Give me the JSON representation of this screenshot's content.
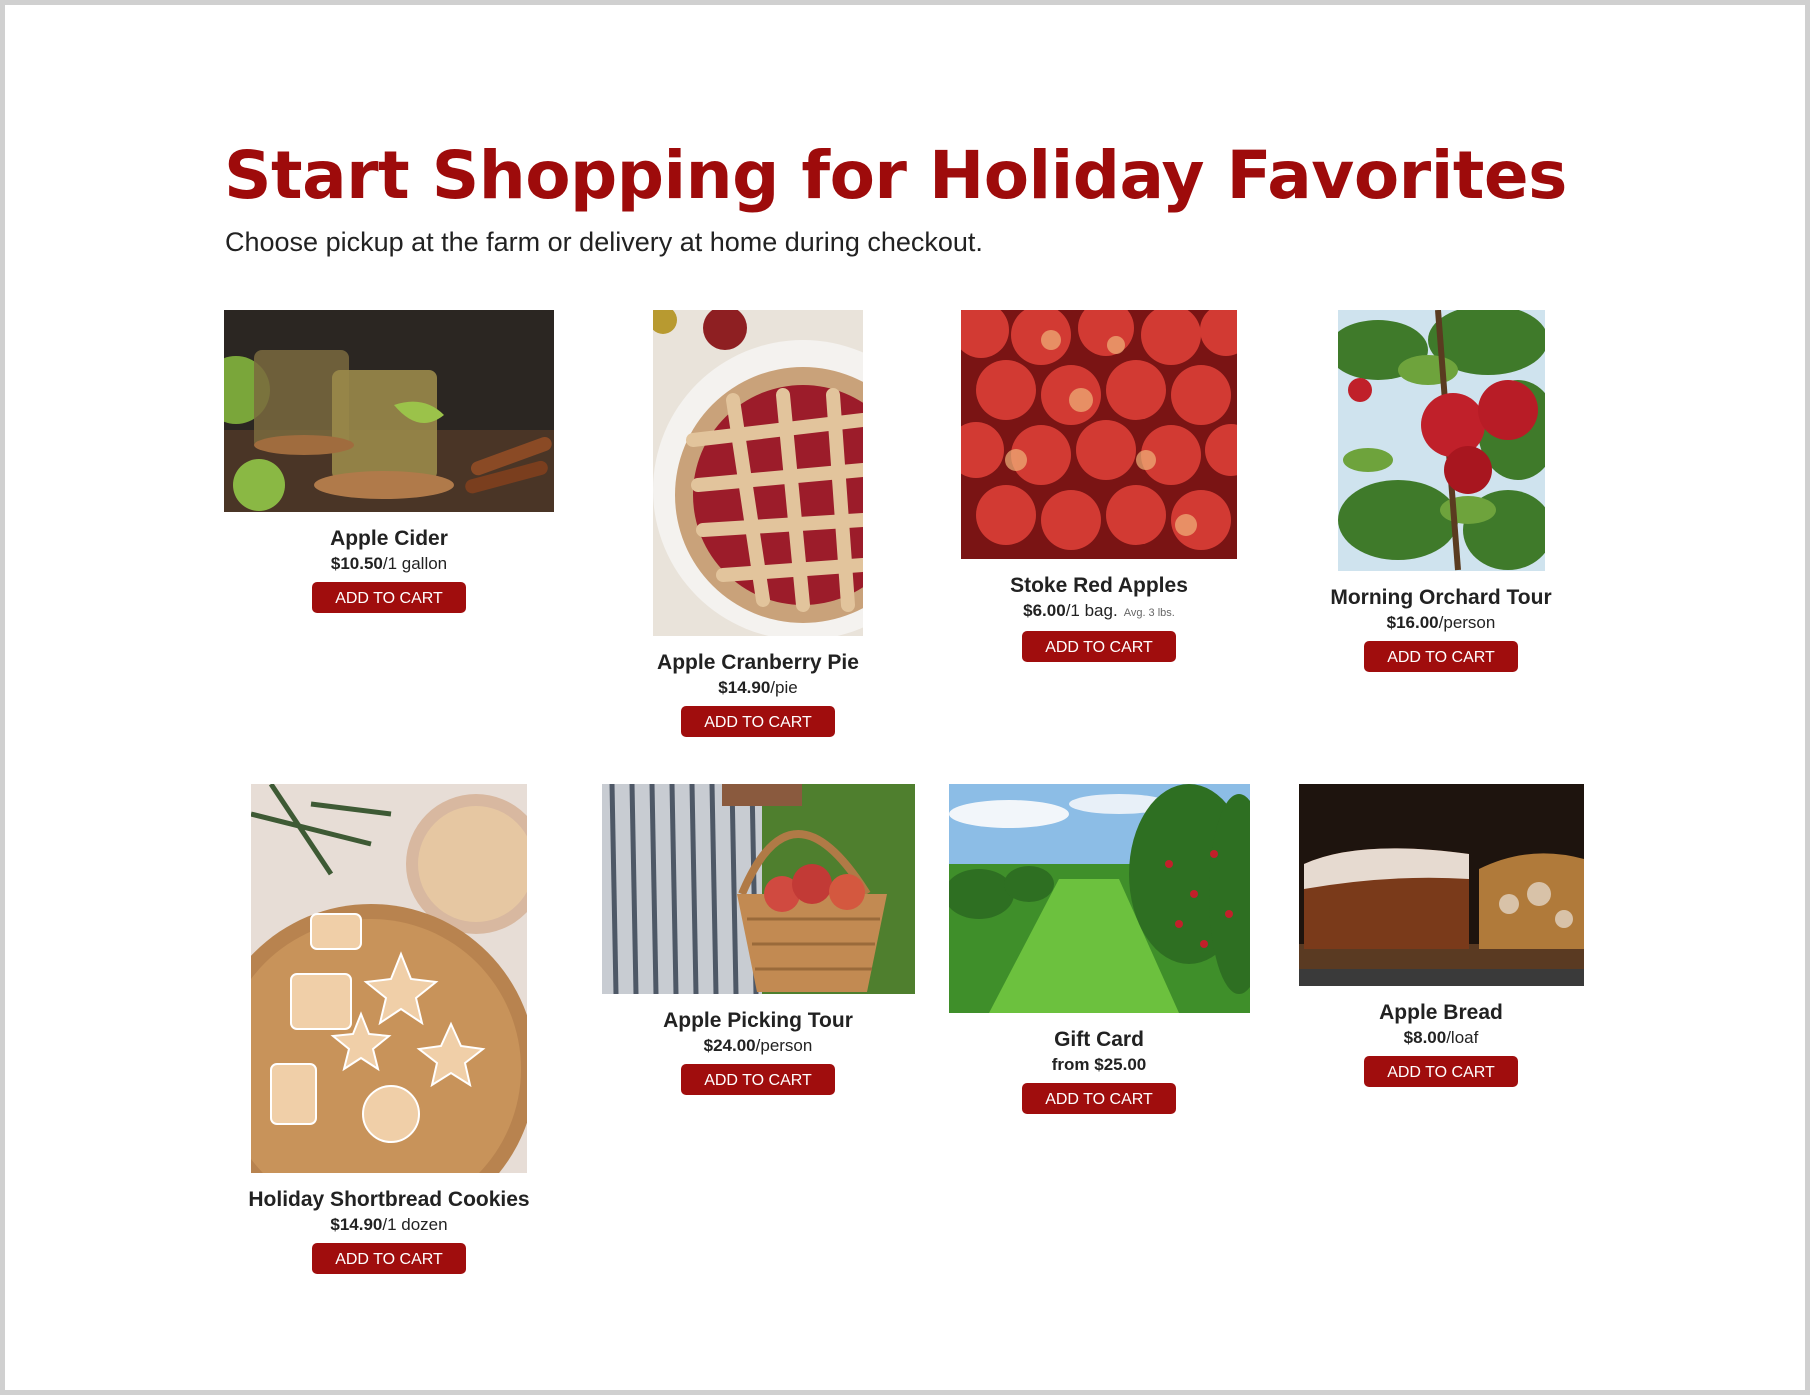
{
  "page": {
    "title": "Start Shopping for Holiday Favorites",
    "subtitle": "Choose pickup at the farm or delivery at home during checkout."
  },
  "colors": {
    "accent": "#9e0b0b",
    "button": "#a00d0d",
    "border": "#d0d0d0"
  },
  "products": [
    {
      "name": "Apple Cider",
      "price": "$10.50",
      "unit": "/1 gallon",
      "note": "",
      "button": "ADD TO CART",
      "image": "apple-cider-photo"
    },
    {
      "name": "Apple Cranberry Pie",
      "price": "$14.90",
      "unit": "/pie",
      "note": "",
      "button": "ADD TO CART",
      "image": "apple-cranberry-pie-photo"
    },
    {
      "name": "Stoke Red Apples",
      "price": "$6.00",
      "unit": "/1 bag.",
      "note": "Avg. 3 lbs.",
      "button": "ADD TO CART",
      "image": "red-apples-photo"
    },
    {
      "name": "Morning Orchard Tour",
      "price": "$16.00",
      "unit": "/person",
      "note": "",
      "button": "ADD TO CART",
      "image": "apple-tree-photo"
    },
    {
      "name": "Holiday Shortbread Cookies",
      "price": "$14.90",
      "unit": "/1 dozen",
      "note": "",
      "button": "ADD TO CART",
      "image": "shortbread-cookies-photo"
    },
    {
      "name": "Apple Picking Tour",
      "price": "$24.00",
      "unit": "/person",
      "note": "",
      "button": "ADD TO CART",
      "image": "apple-basket-photo"
    },
    {
      "name": "Gift Card",
      "price": "from $25.00",
      "unit": "",
      "note": "",
      "button": "ADD TO CART",
      "image": "orchard-rows-photo"
    },
    {
      "name": "Apple Bread",
      "price": "$8.00",
      "unit": "/loaf",
      "note": "",
      "button": "ADD TO CART",
      "image": "apple-bread-photo"
    }
  ]
}
